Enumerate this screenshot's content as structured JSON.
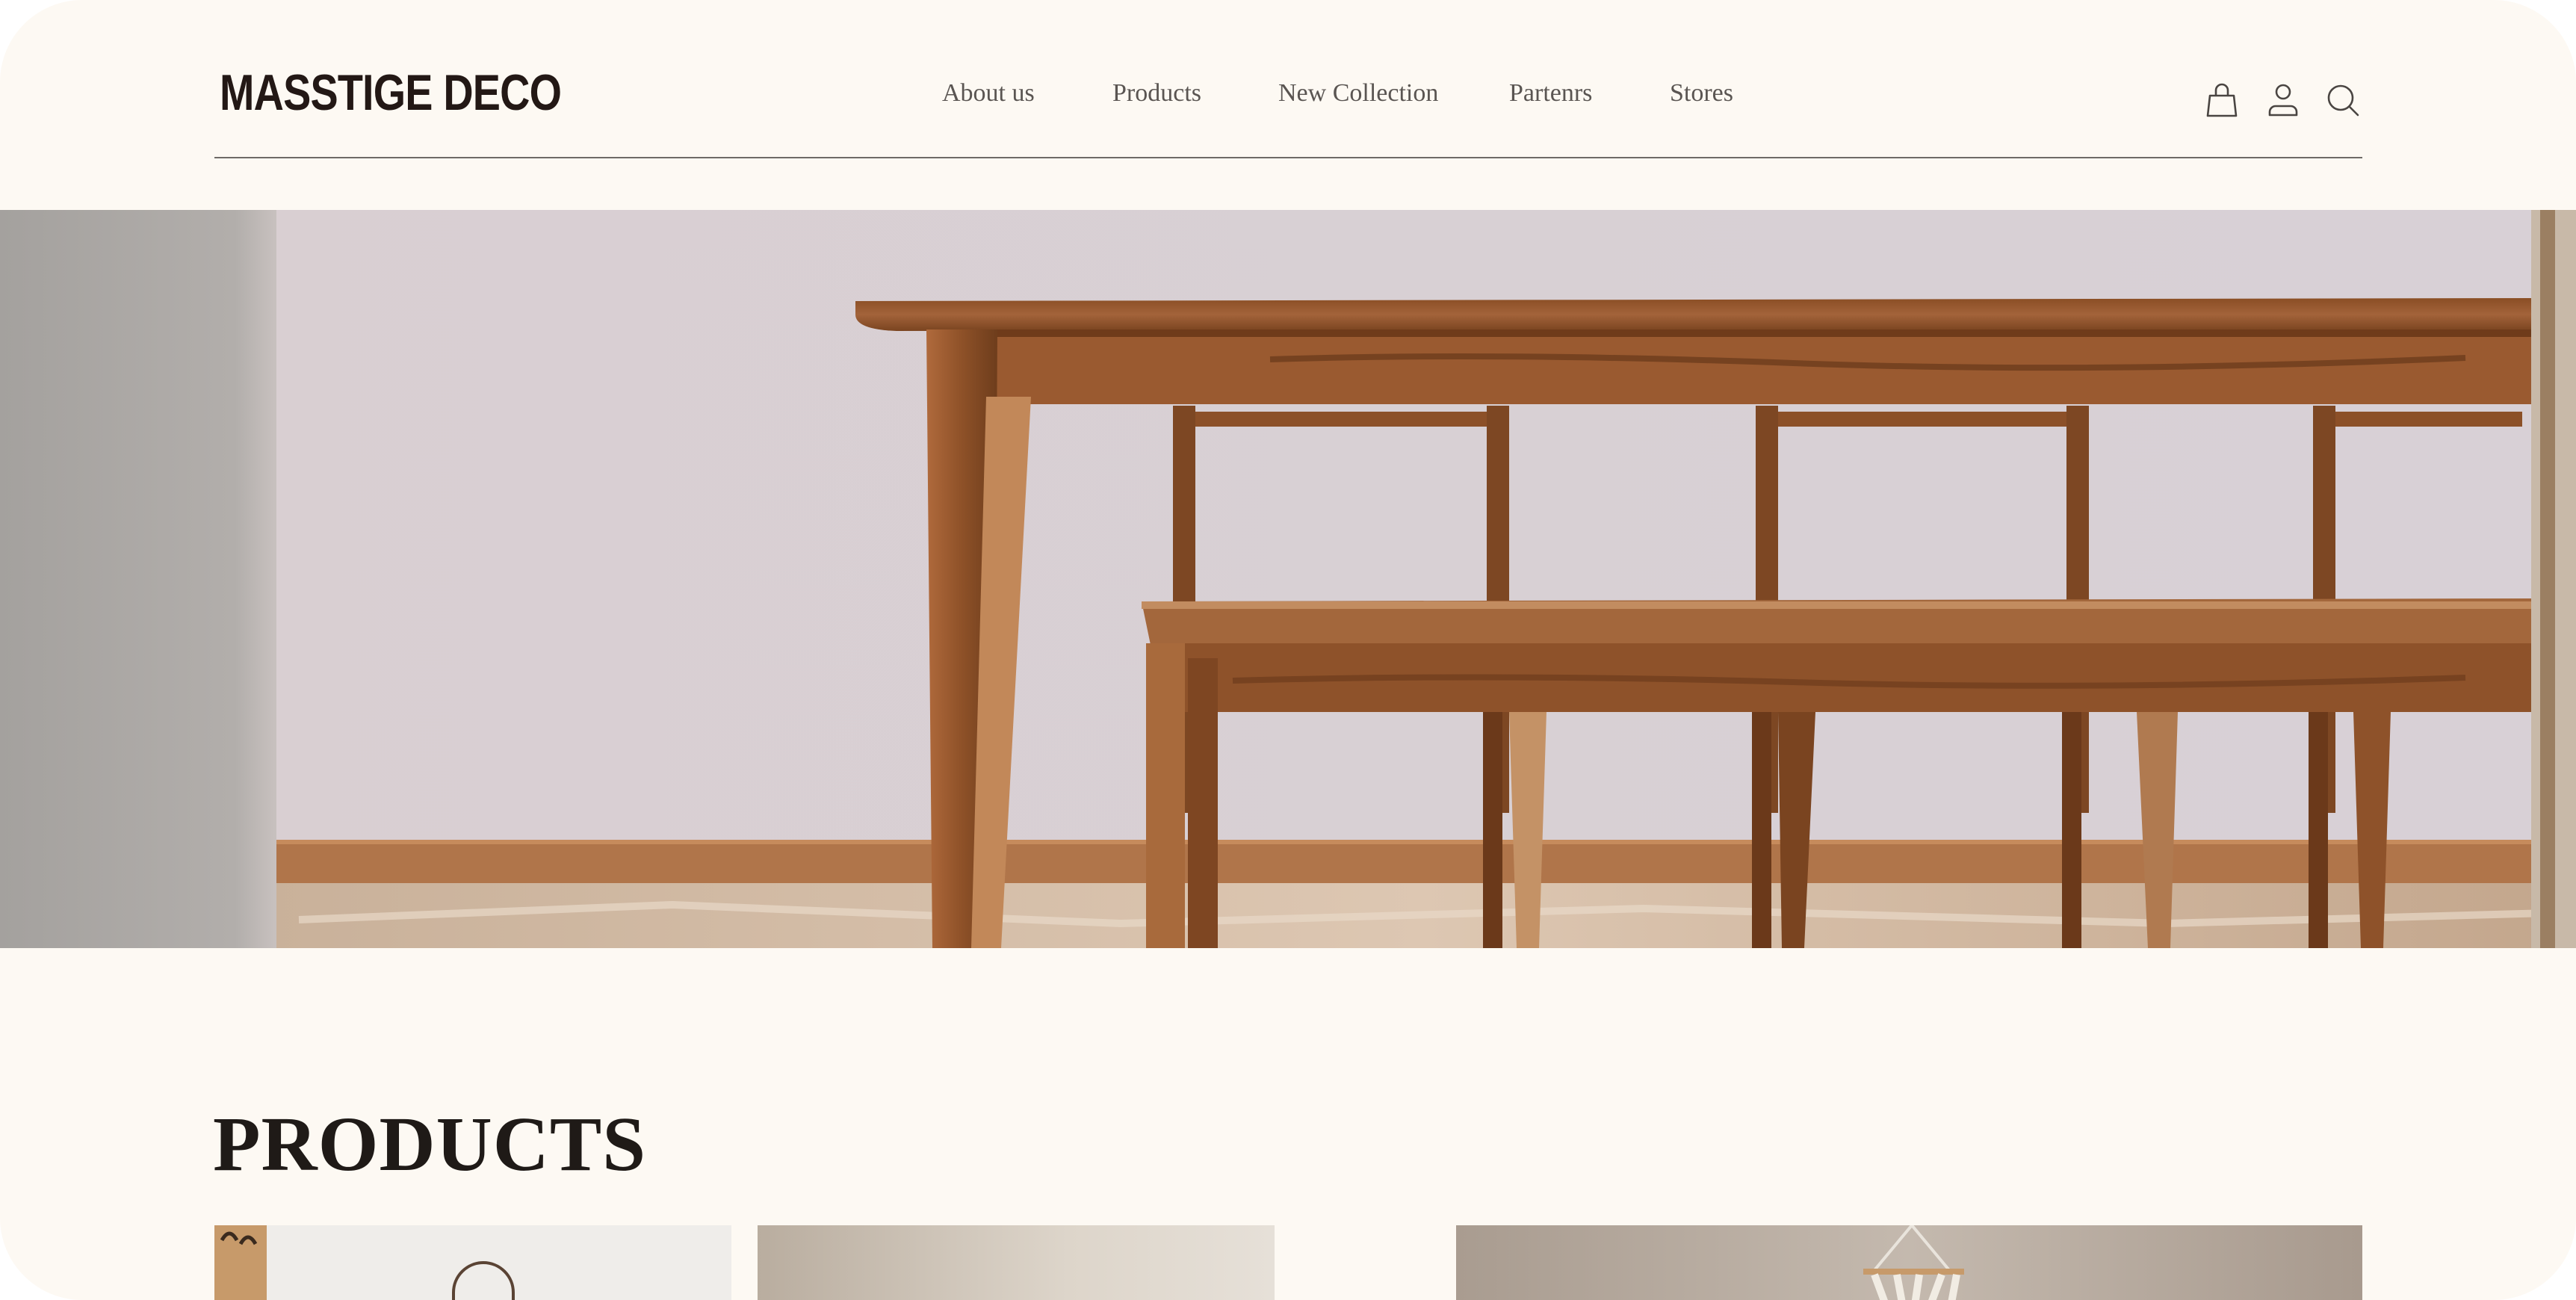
{
  "brand": {
    "name": "MASSTIGE DECO"
  },
  "nav": {
    "items": [
      {
        "label": "About us"
      },
      {
        "label": "Products"
      },
      {
        "label": "New Collection"
      },
      {
        "label": "Partenrs"
      },
      {
        "label": "Stores"
      }
    ]
  },
  "header_icons": [
    "shopping-bag-icon",
    "user-icon",
    "search-icon"
  ],
  "hero": {
    "image": "wooden dining table with bench"
  },
  "products": {
    "title": "PRODUCTS",
    "thumbnails": [
      "coat-rack-mirror",
      "beige-interior",
      "macrame-wall-hanging"
    ]
  },
  "colors": {
    "background": "#fdf9f3",
    "text": "#231815",
    "nav_text": "#5a5552",
    "divider": "#6e6a66"
  }
}
